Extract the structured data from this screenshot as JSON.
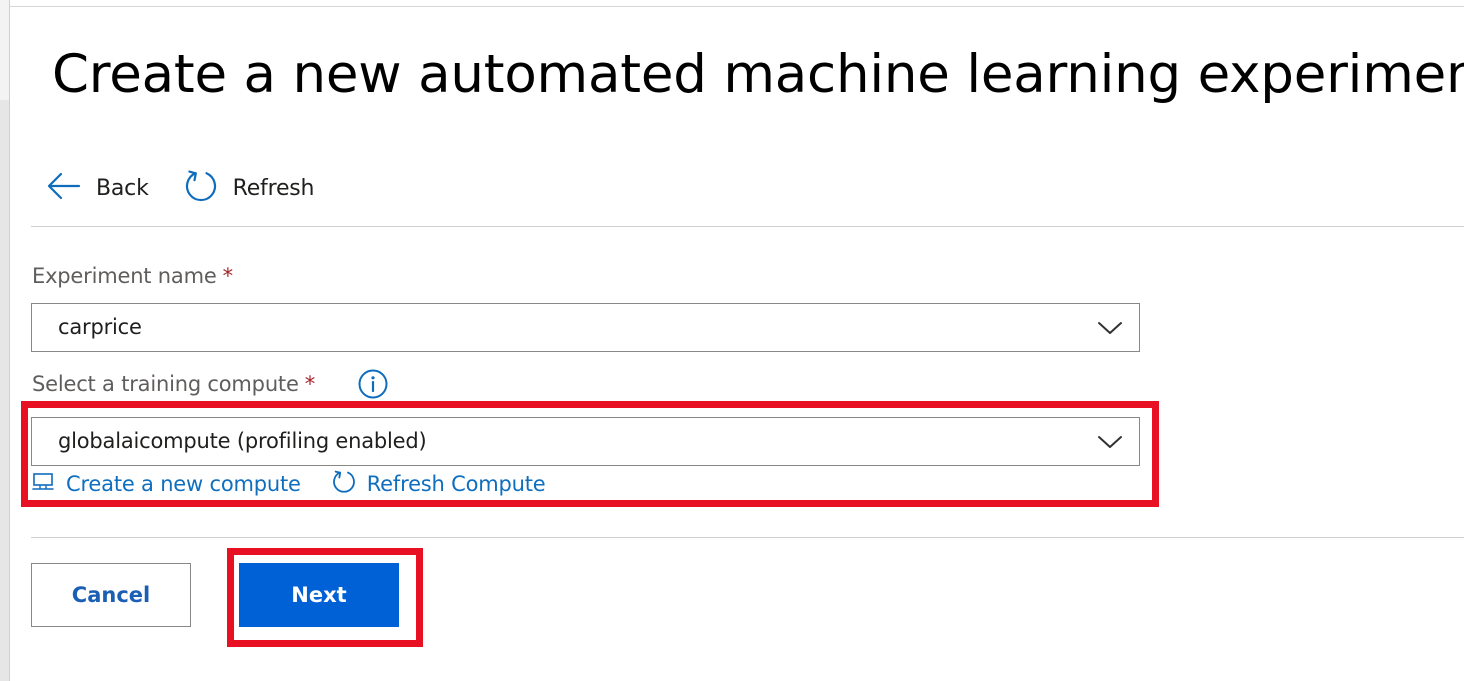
{
  "page": {
    "title": "Create a new automated machine learning experiment"
  },
  "command_bar": {
    "back_label": "Back",
    "refresh_label": "Refresh"
  },
  "form": {
    "experiment": {
      "label": "Experiment name",
      "required_mark": "*",
      "value": "carprice"
    },
    "compute": {
      "label": "Select a training compute",
      "required_mark": "*",
      "value": "globalaicompute (profiling enabled)",
      "create_link": "Create a new compute",
      "refresh_link": "Refresh Compute"
    }
  },
  "buttons": {
    "cancel_label": "Cancel",
    "next_label": "Next"
  },
  "icons": {
    "back": "arrow-left-icon",
    "refresh": "refresh-icon",
    "info": "info-icon",
    "chevron": "chevron-down-icon",
    "create_compute": "monitor-icon",
    "refresh_compute": "refresh-icon"
  },
  "colors": {
    "accent": "#0060d6",
    "link": "#106ebe",
    "required": "#a4262c",
    "highlight": "#e81123"
  }
}
